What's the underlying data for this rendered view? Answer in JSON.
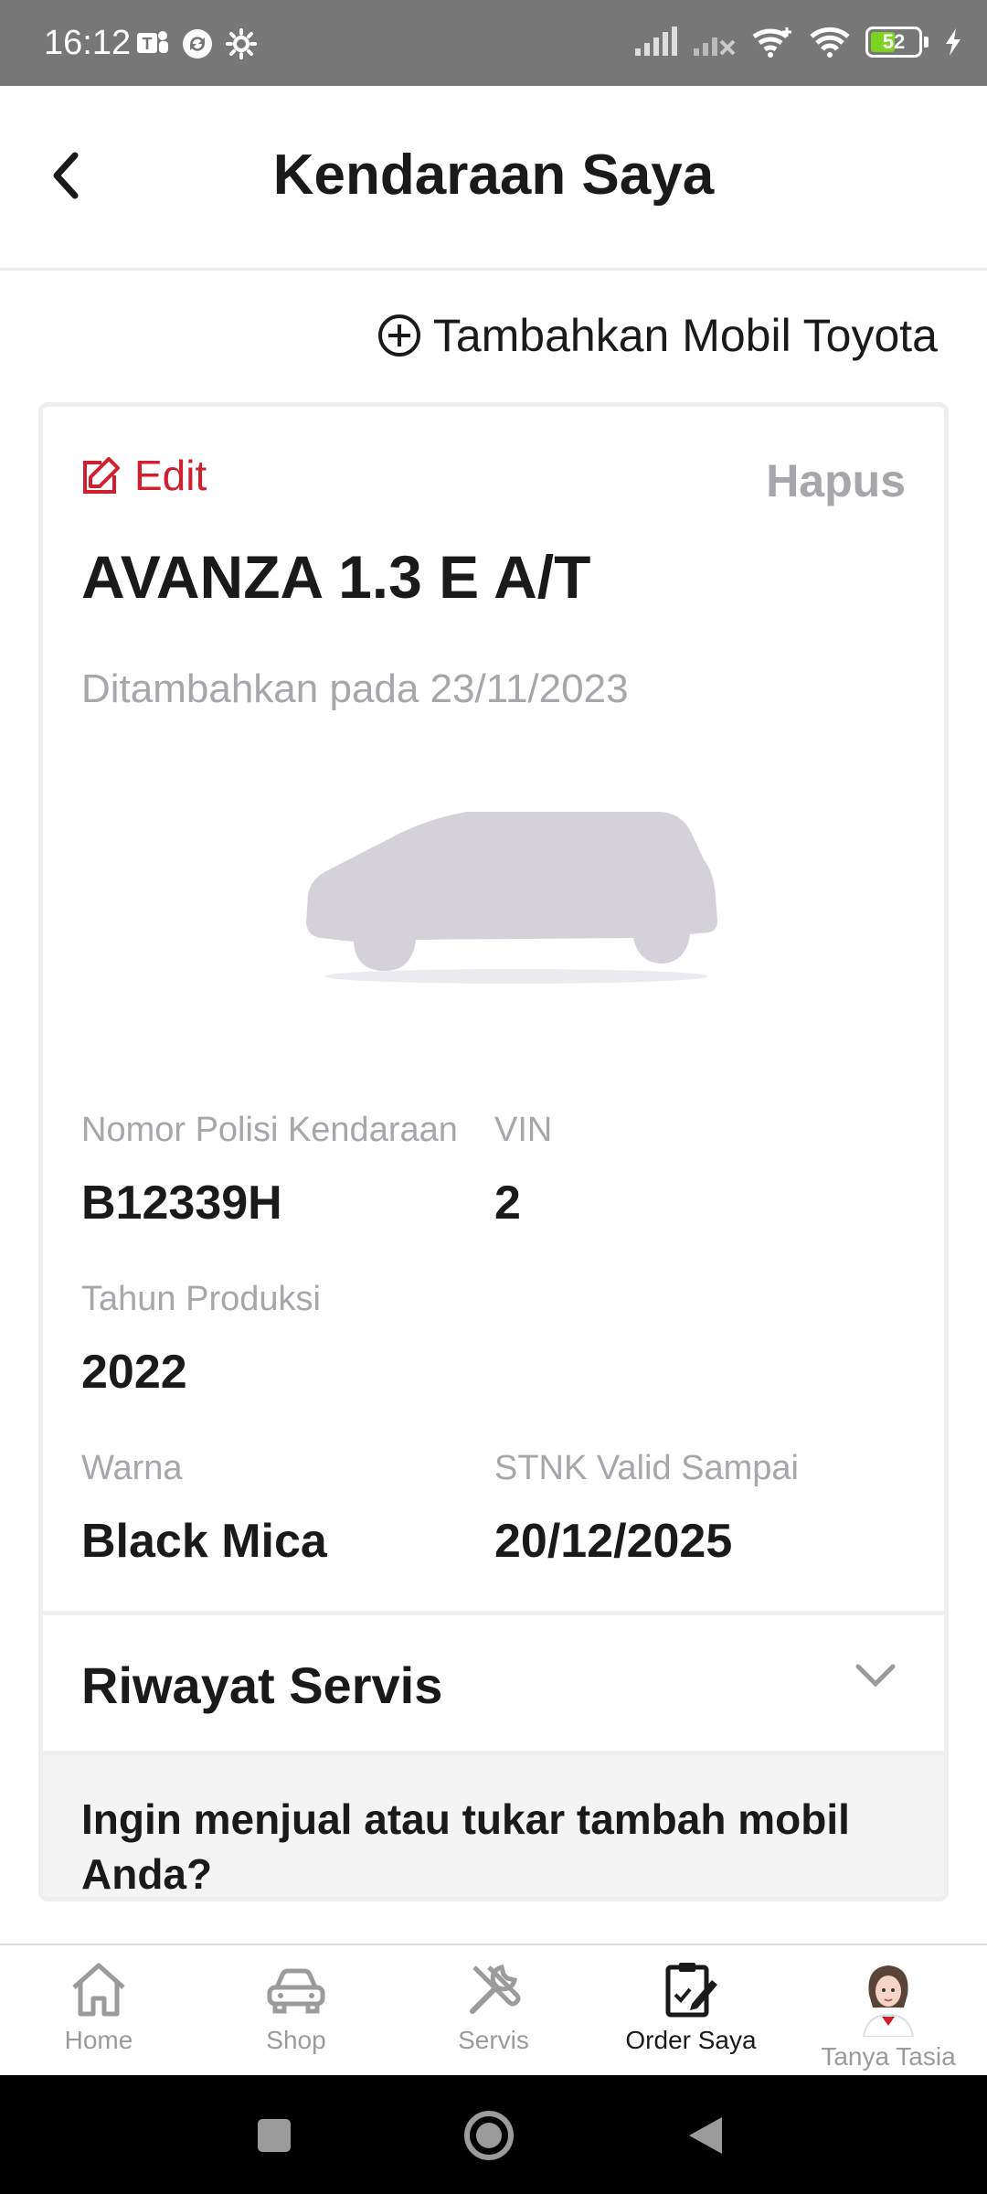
{
  "status_bar": {
    "time": "16:12",
    "battery_level": "52",
    "battery_fraction": 0.52,
    "icons_left": [
      "teams-icon",
      "sync-icon",
      "settings-icon"
    ],
    "icons_right": [
      "signal-icon",
      "signal-x-icon",
      "wifi-plus-icon",
      "wifi-icon",
      "battery-icon",
      "charging-icon"
    ]
  },
  "header": {
    "title": "Kendaraan Saya",
    "back_icon": "chevron-left-icon"
  },
  "add_car": {
    "label": "Tambahkan Mobil Toyota",
    "icon": "plus-circle-icon"
  },
  "vehicle": {
    "edit_label": "Edit",
    "delete_label": "Hapus",
    "model": "AVANZA 1.3 E A/T",
    "added_text": "Ditambahkan pada 23/11/2023",
    "fields": {
      "plate": {
        "label": "Nomor Polisi Kendaraan",
        "value": "B12339H"
      },
      "vin": {
        "label": "VIN",
        "value": "2"
      },
      "year": {
        "label": "Tahun Produksi",
        "value": "2022"
      },
      "color": {
        "label": "Warna",
        "value": "Black Mica"
      },
      "stnk": {
        "label": "STNK Valid Sampai",
        "value": "20/12/2025"
      }
    }
  },
  "service_history": {
    "title": "Riwayat Servis",
    "icon": "chevron-down-icon"
  },
  "sell_prompt": {
    "text": "Ingin menjual atau tukar tambah mobil Anda?"
  },
  "bottom_nav": {
    "active": "Order Saya",
    "items": [
      {
        "label": "Home",
        "icon": "home-icon"
      },
      {
        "label": "Shop",
        "icon": "car-icon"
      },
      {
        "label": "Servis",
        "icon": "tools-icon"
      },
      {
        "label": "Order Saya",
        "icon": "order-icon"
      },
      {
        "label": "Tanya Tasia",
        "icon": "assistant-avatar-icon"
      }
    ]
  },
  "colors": {
    "accent_red": "#d0202e",
    "muted_text": "#a8a6aa",
    "status_bar": "#777777",
    "battery_green": "#7ed321"
  }
}
